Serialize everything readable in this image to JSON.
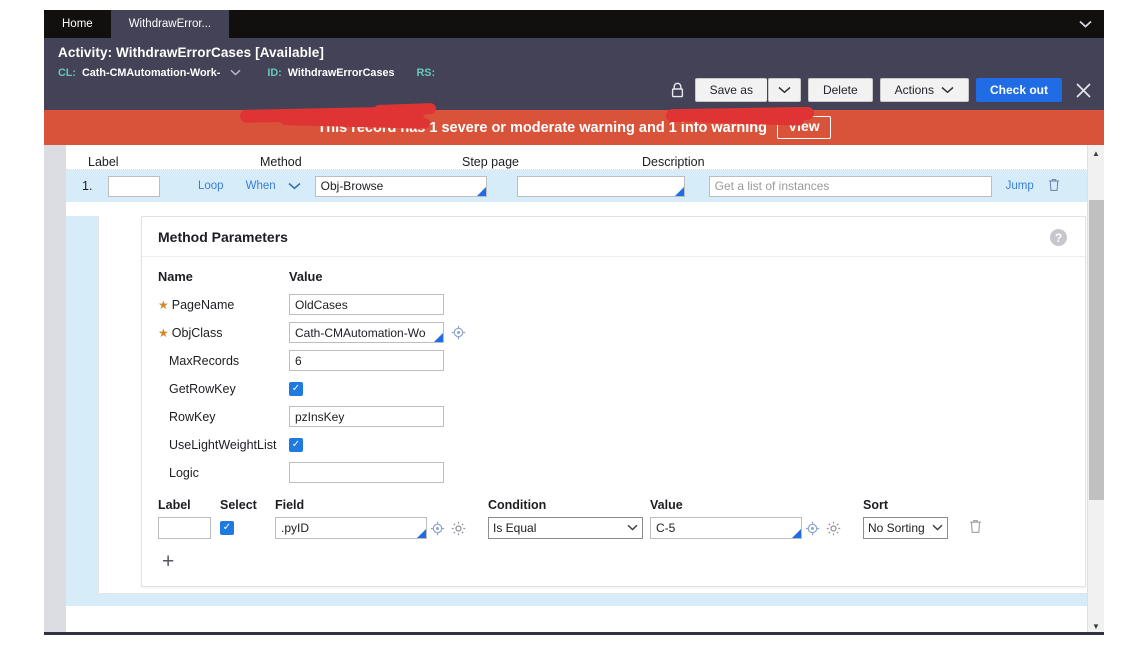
{
  "tabs": [
    {
      "label": "Home",
      "active": false
    },
    {
      "label": "WithdrawError...",
      "active": true
    }
  ],
  "tabstrip": {
    "caret_icon": "chevron-down-icon"
  },
  "header": {
    "title_prefix": "Activity:",
    "title_name": "WithdrawErrorCases",
    "title_status": "[Available]",
    "cl_label": "CL:",
    "cl_value": "Cath-CMAutomation-Work-",
    "cl_caret": "chevron-down-icon",
    "id_label": "ID:",
    "id_value": "WithdrawErrorCases",
    "rs_label": "RS:",
    "rs_value": ""
  },
  "actionbar": {
    "lock_icon": "lock-icon",
    "save_as_label": "Save as",
    "save_as_caret": "chevron-down-icon",
    "delete_label": "Delete",
    "actions_label": "Actions",
    "actions_caret": "chevron-down-icon",
    "checkout_label": "Check out",
    "close_icon": "close-icon",
    "primary_color": "#1f6ce4"
  },
  "warning": {
    "text": "This record has 1 severe or moderate warning and 1 info warning",
    "view_label": "View",
    "bar_color": "#d9533a"
  },
  "columns": {
    "label": "Label",
    "method": "Method",
    "step_page": "Step page",
    "description": "Description"
  },
  "step": {
    "number": "1.",
    "label_value": "",
    "loop_label": "Loop",
    "when_label": "When",
    "when_caret": "chevron-down-icon",
    "method_value": "Obj-Browse",
    "step_page_value": "",
    "description_placeholder": "Get a list of instances",
    "jump_label": "Jump",
    "delete_icon": "trash-icon"
  },
  "method_parameters": {
    "title": "Method Parameters",
    "help_icon": "help-icon",
    "head_name": "Name",
    "head_value": "Value",
    "rows": [
      {
        "name": "PageName",
        "required": true,
        "type": "text",
        "value": "OldCases",
        "has_picker": false,
        "has_gear": false
      },
      {
        "name": "ObjClass",
        "required": true,
        "type": "text",
        "value": "Cath-CMAutomation-Wo",
        "has_picker": true,
        "has_gear": false
      },
      {
        "name": "MaxRecords",
        "required": false,
        "type": "text",
        "value": "6",
        "has_picker": false,
        "has_gear": false
      },
      {
        "name": "GetRowKey",
        "required": false,
        "type": "checkbox",
        "checked": true
      },
      {
        "name": "RowKey",
        "required": false,
        "type": "text",
        "value": "pzInsKey",
        "has_picker": false,
        "has_gear": false
      },
      {
        "name": "UseLightWeightList",
        "required": false,
        "type": "checkbox",
        "checked": true
      },
      {
        "name": "Logic",
        "required": false,
        "type": "text",
        "value": "",
        "has_picker": false,
        "has_gear": false
      }
    ]
  },
  "filter_table": {
    "headers": {
      "label": "Label",
      "select": "Select",
      "field": "Field",
      "condition": "Condition",
      "value": "Value",
      "sort": "Sort"
    },
    "row": {
      "label_value": "",
      "select_checked": true,
      "field_value": ".pyID",
      "field_picker_icon": "crosshair-icon",
      "field_gear_icon": "gear-icon",
      "condition_value": "Is Equal",
      "condition_caret": "chevron-down-icon",
      "value_value": "C-5",
      "value_picker_icon": "crosshair-icon",
      "value_gear_icon": "gear-icon",
      "sort_value": "No Sorting",
      "sort_caret": "chevron-down-icon",
      "delete_icon": "trash-icon"
    },
    "add_row_icon": "plus-icon"
  },
  "scrollbar": {
    "up_icon": "caret-up-icon",
    "down_icon": "caret-down-icon"
  }
}
